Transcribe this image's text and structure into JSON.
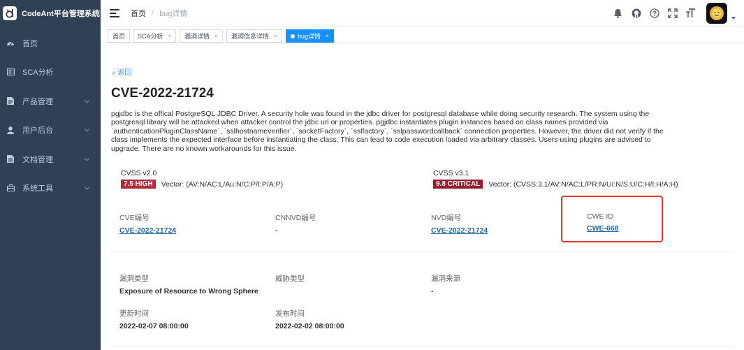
{
  "app": {
    "title": "CodeAnt平台管理系统"
  },
  "sidebar": {
    "items": [
      {
        "label": "首页",
        "icon": "dashboard-icon",
        "has_children": false
      },
      {
        "label": "SCA分析",
        "icon": "table-icon",
        "has_children": false
      },
      {
        "label": "产品管理",
        "icon": "document-icon",
        "has_children": true
      },
      {
        "label": "用户后台",
        "icon": "user-icon",
        "has_children": true
      },
      {
        "label": "文档管理",
        "icon": "file-icon",
        "has_children": true
      },
      {
        "label": "系统工具",
        "icon": "toolbox-icon",
        "has_children": true
      }
    ]
  },
  "navbar": {
    "breadcrumb": {
      "home": "首页",
      "separator": "/",
      "current": "bug详情"
    },
    "icons": [
      "bell-icon",
      "github-icon",
      "help-icon",
      "fullscreen-icon",
      "font-size-icon"
    ]
  },
  "tags": [
    {
      "label": "首页",
      "closable": false,
      "active": false
    },
    {
      "label": "SCA分析",
      "closable": true,
      "active": false
    },
    {
      "label": "漏洞详情",
      "closable": true,
      "active": false
    },
    {
      "label": "漏洞信息详情",
      "closable": true,
      "active": false
    },
    {
      "label": "bug详情",
      "closable": true,
      "active": true
    }
  ],
  "detail": {
    "back_label": "« 返回",
    "title": "CVE-2022-21724",
    "description": "pgjdbc is the offical PostgreSQL JDBC Driver. A security hole was found in the jdbc driver for postgresql database while doing security research. The system using the postgresql library will be attacked when attacker control the jdbc url or properties. pgjdbc instantiates plugin instances based on class names provided via `authenticationPluginClassName`, `sslhostnameverifier`, `socketFactory`, `sslfactory`, `sslpasswordcallback` connection properties. However, the driver did not verify if the class implements the expected interface before instantiating the class. This can lead to code execution loaded via arbitrary classes. Users using plugins are advised to upgrade. There are no known workarounds for this issue.",
    "cvss2": {
      "label": "CVSS v2.0",
      "badge": "7.5 HIGH",
      "vector": "Vector: (AV:N/AC:L/Au:N/C:P/I:P/A:P)"
    },
    "cvss3": {
      "label": "CVSS v3.1",
      "badge": "9.8 CRITICAL",
      "vector": "Vector: (CVSS:3.1/AV:N/AC:L/PR:N/UI:N/S:U/C:H/I:H/A:H)"
    },
    "ids": {
      "cve_label": "CVE编号",
      "cve_value": "CVE-2022-21724",
      "cnnvd_label": "CNNVD编号",
      "cnnvd_value": "-",
      "nvd_label": "NVD编号",
      "nvd_value": "CVE-2022-21724",
      "cwe_label": "CWE ID",
      "cwe_value": "CWE-668"
    },
    "info": {
      "vuln_type_label": "漏洞类型",
      "vuln_type_value": "Exposure of Resource to Wrong Sphere",
      "threat_type_label": "威胁类型",
      "threat_type_value": "",
      "source_label": "漏洞来源",
      "source_value": "-",
      "updated_label": "更新时间",
      "updated_value": "2022-02-07 08:00:00",
      "published_label": "发布时间",
      "published_value": "2022-02-02 08:00:00"
    }
  },
  "colors": {
    "sidebar_bg": "#304156",
    "accent_blue": "#1890ff",
    "highlight": "#e13a2f",
    "link": "#1f6aa5",
    "cvss_high": "#b32a3d",
    "cvss_critical": "#9b1b2f"
  }
}
